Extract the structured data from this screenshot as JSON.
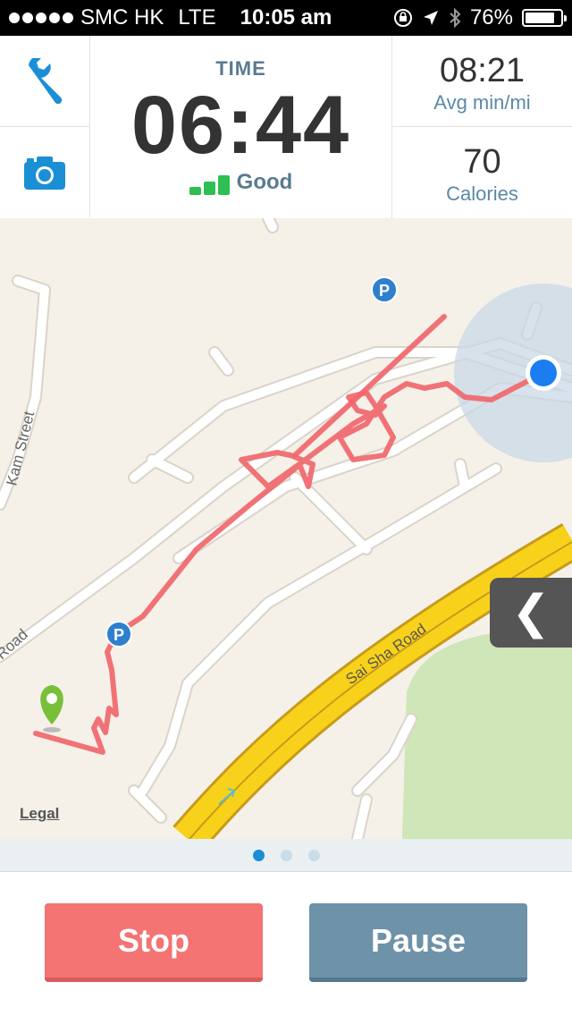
{
  "status_bar": {
    "carrier": "SMC HK",
    "network": "LTE",
    "time": "10:05 am",
    "battery": "76%"
  },
  "stats": {
    "time_label": "TIME",
    "time_value": "06:44",
    "signal_text": "Good",
    "pace_value": "08:21",
    "pace_label": "Avg min/mi",
    "calories_value": "70",
    "calories_label": "Calories"
  },
  "map": {
    "street_1": "Kam Street",
    "street_2": "Road",
    "street_3": "Sai Sha Road",
    "legal": "Legal",
    "parking": "P"
  },
  "pager": {
    "pages": 3,
    "active": 0
  },
  "buttons": {
    "stop": "Stop",
    "pause": "Pause"
  },
  "colors": {
    "route": "#f0676b",
    "accent_blue": "#1a8fd6",
    "stop": "#f47373",
    "pause": "#6e92a8",
    "signal": "#2dbf52"
  }
}
